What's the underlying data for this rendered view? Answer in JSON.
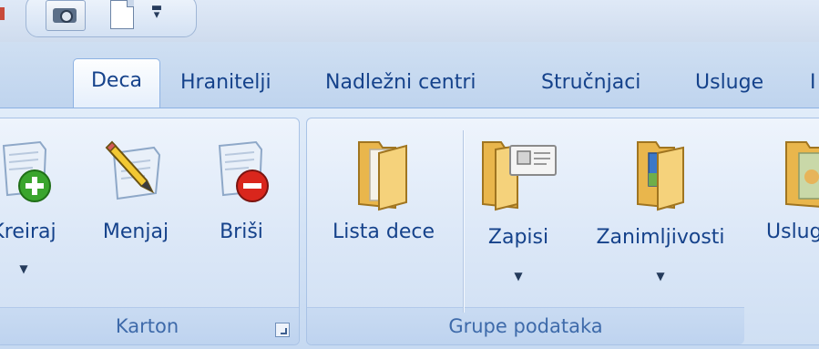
{
  "tabs": [
    {
      "label": "Deca",
      "active": true
    },
    {
      "label": "Hranitelji"
    },
    {
      "label": "Nadležni centri"
    },
    {
      "label": "Stručnjaci"
    },
    {
      "label": "Usluge"
    },
    {
      "label": "I"
    }
  ],
  "groups": {
    "karton": {
      "caption": "Karton",
      "buttons": {
        "kreiraj": {
          "label": "Kreiraj",
          "icon": "document-add-icon"
        },
        "menjaj": {
          "label": "Menjaj",
          "icon": "document-edit-icon"
        },
        "brisi": {
          "label": "Briši",
          "icon": "document-delete-icon"
        }
      }
    },
    "grupe": {
      "caption": "Grupe podataka",
      "buttons": {
        "lista": {
          "label": "Lista dece",
          "icon": "folder-icon"
        },
        "zapisi": {
          "label": "Zapisi",
          "icon": "folder-records-icon"
        },
        "zanimljivosti": {
          "label": "Zanimljivosti",
          "icon": "folder-picture-icon"
        },
        "usluge": {
          "label": "Usluge",
          "icon": "folder-services-icon"
        }
      }
    }
  },
  "colors": {
    "ribbon_text": "#15428b",
    "group_caption": "#3e6aaa",
    "add_green": "#3aa52d",
    "delete_red": "#d9261c"
  }
}
